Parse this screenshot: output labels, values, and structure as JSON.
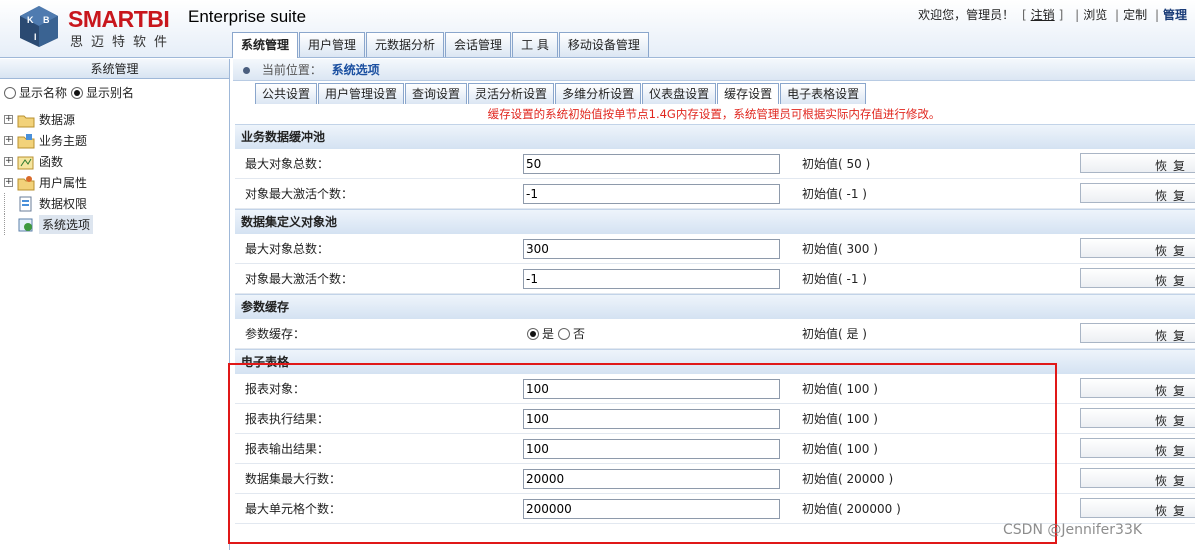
{
  "header": {
    "brand_name": "SMARTBI",
    "brand_cn": "思迈特软件",
    "suite": "Enterprise suite",
    "welcome": "欢迎您，管理员！",
    "logout": "注销",
    "links": [
      "浏览",
      "定制",
      "管理"
    ]
  },
  "main_tabs": [
    "系统管理",
    "用户管理",
    "元数据分析",
    "会话管理",
    "工 具",
    "移动设备管理"
  ],
  "sidebar": {
    "title": "系统管理",
    "show_name": "显示名称",
    "show_alias": "显示别名",
    "items": [
      "数据源",
      "业务主题",
      "函数",
      "用户属性",
      "数据权限",
      "系统选项"
    ]
  },
  "breadcrumb": {
    "label": "当前位置：",
    "current": "系统选项"
  },
  "sub_tabs": [
    "公共设置",
    "用户管理设置",
    "查询设置",
    "灵活分析设置",
    "多维分析设置",
    "仪表盘设置",
    "缓存设置",
    "电子表格设置"
  ],
  "notice": "缓存设置的系统初始值按单节点1.4G内存设置，系统管理员可根据实际内存值进行修改。",
  "restore_label": "恢复",
  "sections": {
    "s1": {
      "title": "业务数据缓冲池",
      "r1": {
        "label": "最大对象总数：",
        "value": "50",
        "initial": "初始值( 50 )"
      },
      "r2": {
        "label": "对象最大激活个数：",
        "value": "-1",
        "initial": "初始值( -1 )"
      }
    },
    "s2": {
      "title": "数据集定义对象池",
      "r1": {
        "label": "最大对象总数：",
        "value": "300",
        "initial": "初始值( 300 )"
      },
      "r2": {
        "label": "对象最大激活个数：",
        "value": "-1",
        "initial": "初始值( -1 )"
      }
    },
    "s3": {
      "title": "参数缓存",
      "r1": {
        "label": "参数缓存：",
        "yes": "是",
        "no": "否",
        "initial": "初始值( 是 )"
      }
    },
    "s4": {
      "title": "电子表格",
      "r1": {
        "label": "报表对象：",
        "value": "100",
        "initial": "初始值( 100 )"
      },
      "r2": {
        "label": "报表执行结果：",
        "value": "100",
        "initial": "初始值( 100 )"
      },
      "r3": {
        "label": "报表输出结果：",
        "value": "100",
        "initial": "初始值( 100 )"
      },
      "r4": {
        "label": "数据集最大行数：",
        "value": "20000",
        "initial": "初始值( 20000 )"
      },
      "r5": {
        "label": "最大单元格个数：",
        "value": "200000",
        "initial": "初始值( 200000 )"
      }
    }
  },
  "watermark": "CSDN @Jennifer33K"
}
